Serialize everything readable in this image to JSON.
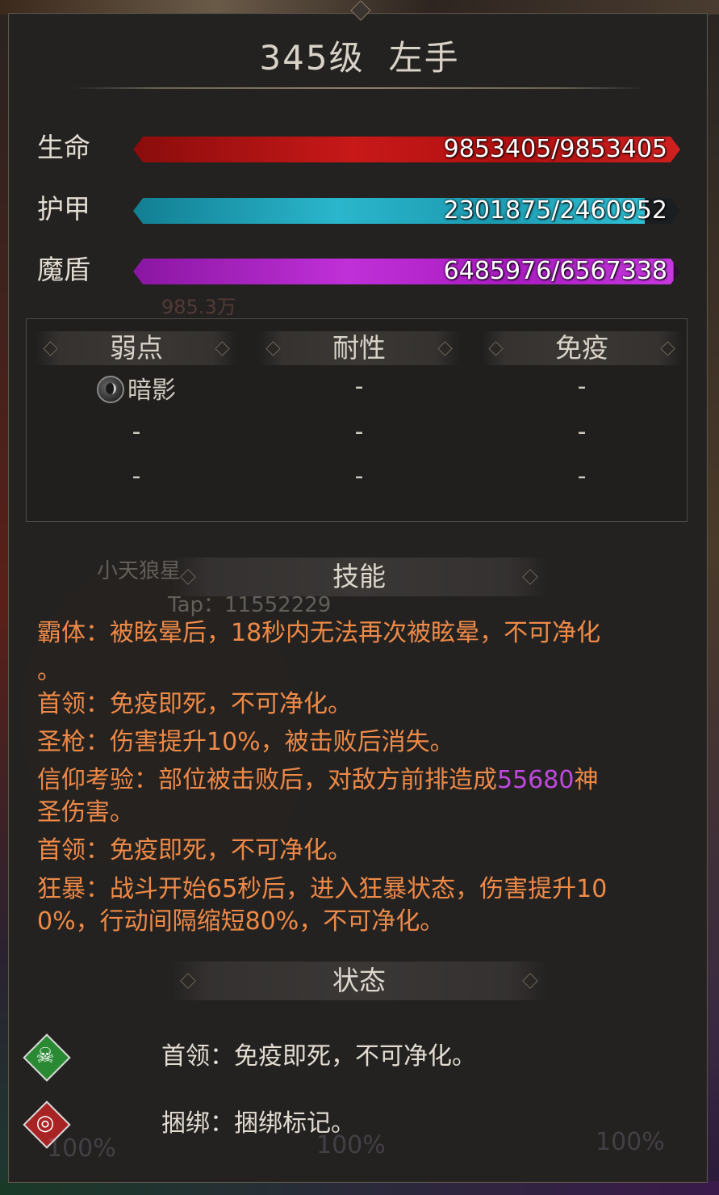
{
  "title": {
    "level": "345级",
    "name": "左手"
  },
  "stats": [
    {
      "label": "生命",
      "current": 9853405,
      "max": 9853405,
      "text": "9853405/9853405",
      "color": "#c81818"
    },
    {
      "label": "护甲",
      "current": 2301875,
      "max": 2460952,
      "text": "2301875/2460952",
      "color": "#2ab6cc"
    },
    {
      "label": "魔盾",
      "current": 6485976,
      "max": 6567338,
      "text": "6485976/6567338",
      "color": "#c030d8"
    }
  ],
  "background_text": {
    "damage": "985.3万"
  },
  "resistances": {
    "headers": {
      "weakness": "弱点",
      "resistance": "耐性",
      "immunity": "免疫"
    },
    "weakness": [
      "暗影",
      "-",
      "-"
    ],
    "resistance": [
      "-",
      "-",
      "-"
    ],
    "immunity": [
      "-",
      "-",
      "-"
    ],
    "weakness_icon": "shadow-icon"
  },
  "watermark": {
    "name": "小天狼星",
    "tap": "Tap：11552229"
  },
  "skills": {
    "header": "技能",
    "lines": [
      "霸体：被眩晕后，18秒内无法再次被眩晕，不可净化",
      "。",
      "首领：免疫即死，不可净化。",
      "圣枪：伤害提升10%，被击败后消失。",
      {
        "before": "信仰考验：部位被击败后，对敌方前排造成",
        "highlight": "55680",
        "after": "神"
      },
      "圣伤害。",
      "首领：免疫即死，不可净化。",
      "狂暴：战斗开始65秒后，进入狂暴状态，伤害提升10",
      "0%，行动间隔缩短80%，不可净化。"
    ],
    "text_color": "#ee8a48",
    "highlight_color": "#c048e0"
  },
  "states": {
    "header": "状态",
    "items": [
      {
        "icon": "skull-icon",
        "text": "首领：免疫即死，不可净化。",
        "color": "#2a8a34"
      },
      {
        "icon": "bind-target-icon",
        "text": "捆绑：捆绑标记。",
        "color": "#a82424"
      }
    ]
  },
  "background_percent": [
    "100%",
    "100%",
    "100%"
  ]
}
